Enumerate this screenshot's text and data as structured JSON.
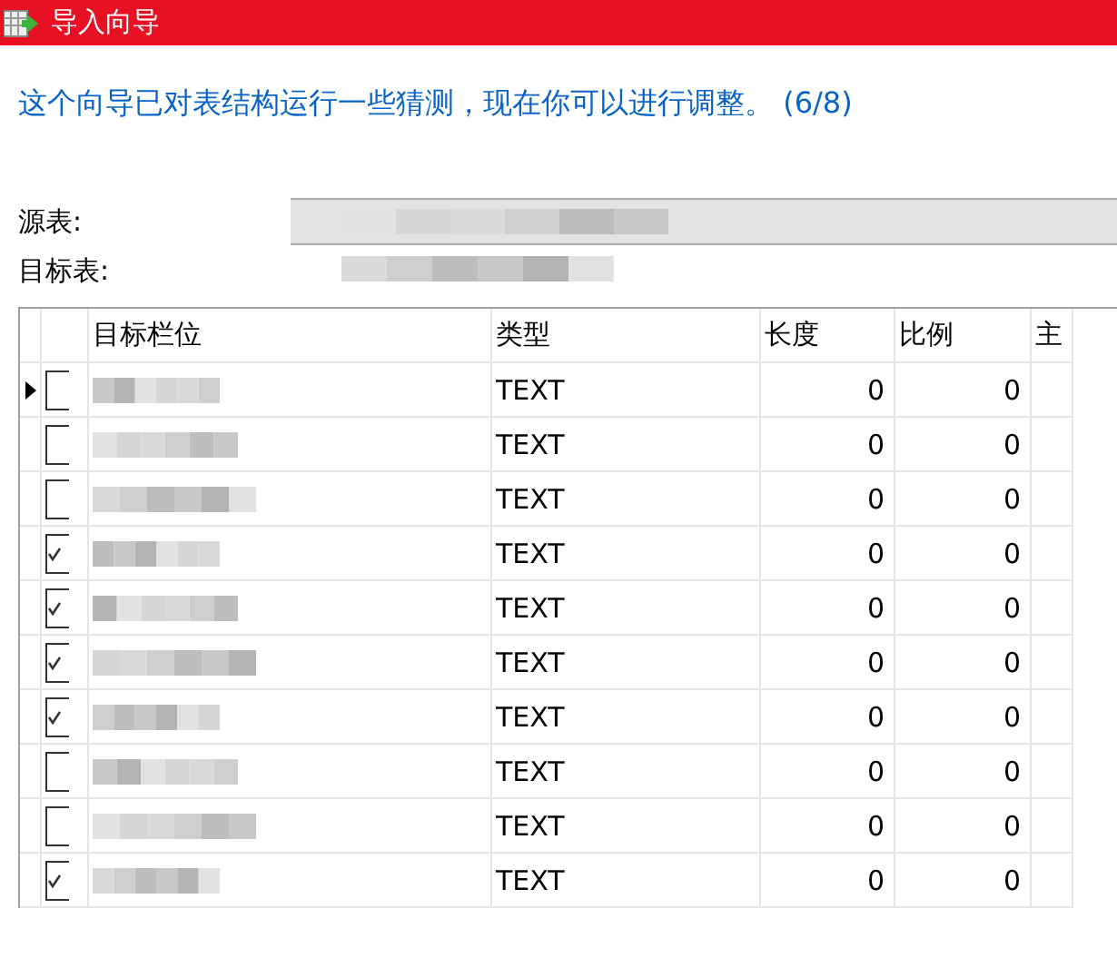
{
  "window": {
    "title": "导入向导"
  },
  "heading": "这个向导已对表结构运行一些猜测，现在你可以进行调整。 (6/8)",
  "source": {
    "label": "源表:",
    "value_redacted": true
  },
  "target": {
    "label": "目标表:",
    "value_redacted": true
  },
  "table": {
    "columns": [
      "目标栏位",
      "类型",
      "长度",
      "比例",
      "主"
    ],
    "rows": [
      {
        "current": true,
        "checked": false,
        "field_redacted": true,
        "type": "TEXT",
        "length": "0",
        "scale": "0"
      },
      {
        "current": false,
        "checked": false,
        "field_redacted": true,
        "type": "TEXT",
        "length": "0",
        "scale": "0"
      },
      {
        "current": false,
        "checked": false,
        "field_redacted": true,
        "type": "TEXT",
        "length": "0",
        "scale": "0"
      },
      {
        "current": false,
        "checked": true,
        "field_redacted": true,
        "type": "TEXT",
        "length": "0",
        "scale": "0"
      },
      {
        "current": false,
        "checked": true,
        "field_redacted": true,
        "type": "TEXT",
        "length": "0",
        "scale": "0"
      },
      {
        "current": false,
        "checked": true,
        "field_redacted": true,
        "type": "TEXT",
        "length": "0",
        "scale": "0"
      },
      {
        "current": false,
        "checked": true,
        "field_redacted": true,
        "type": "TEXT",
        "length": "0",
        "scale": "0"
      },
      {
        "current": false,
        "checked": false,
        "field_redacted": true,
        "type": "TEXT",
        "length": "0",
        "scale": "0"
      },
      {
        "current": false,
        "checked": false,
        "field_redacted": true,
        "type": "TEXT",
        "length": "0",
        "scale": "0"
      },
      {
        "current": false,
        "checked": true,
        "field_redacted": true,
        "type": "TEXT",
        "length": "0",
        "scale": "0"
      }
    ]
  }
}
